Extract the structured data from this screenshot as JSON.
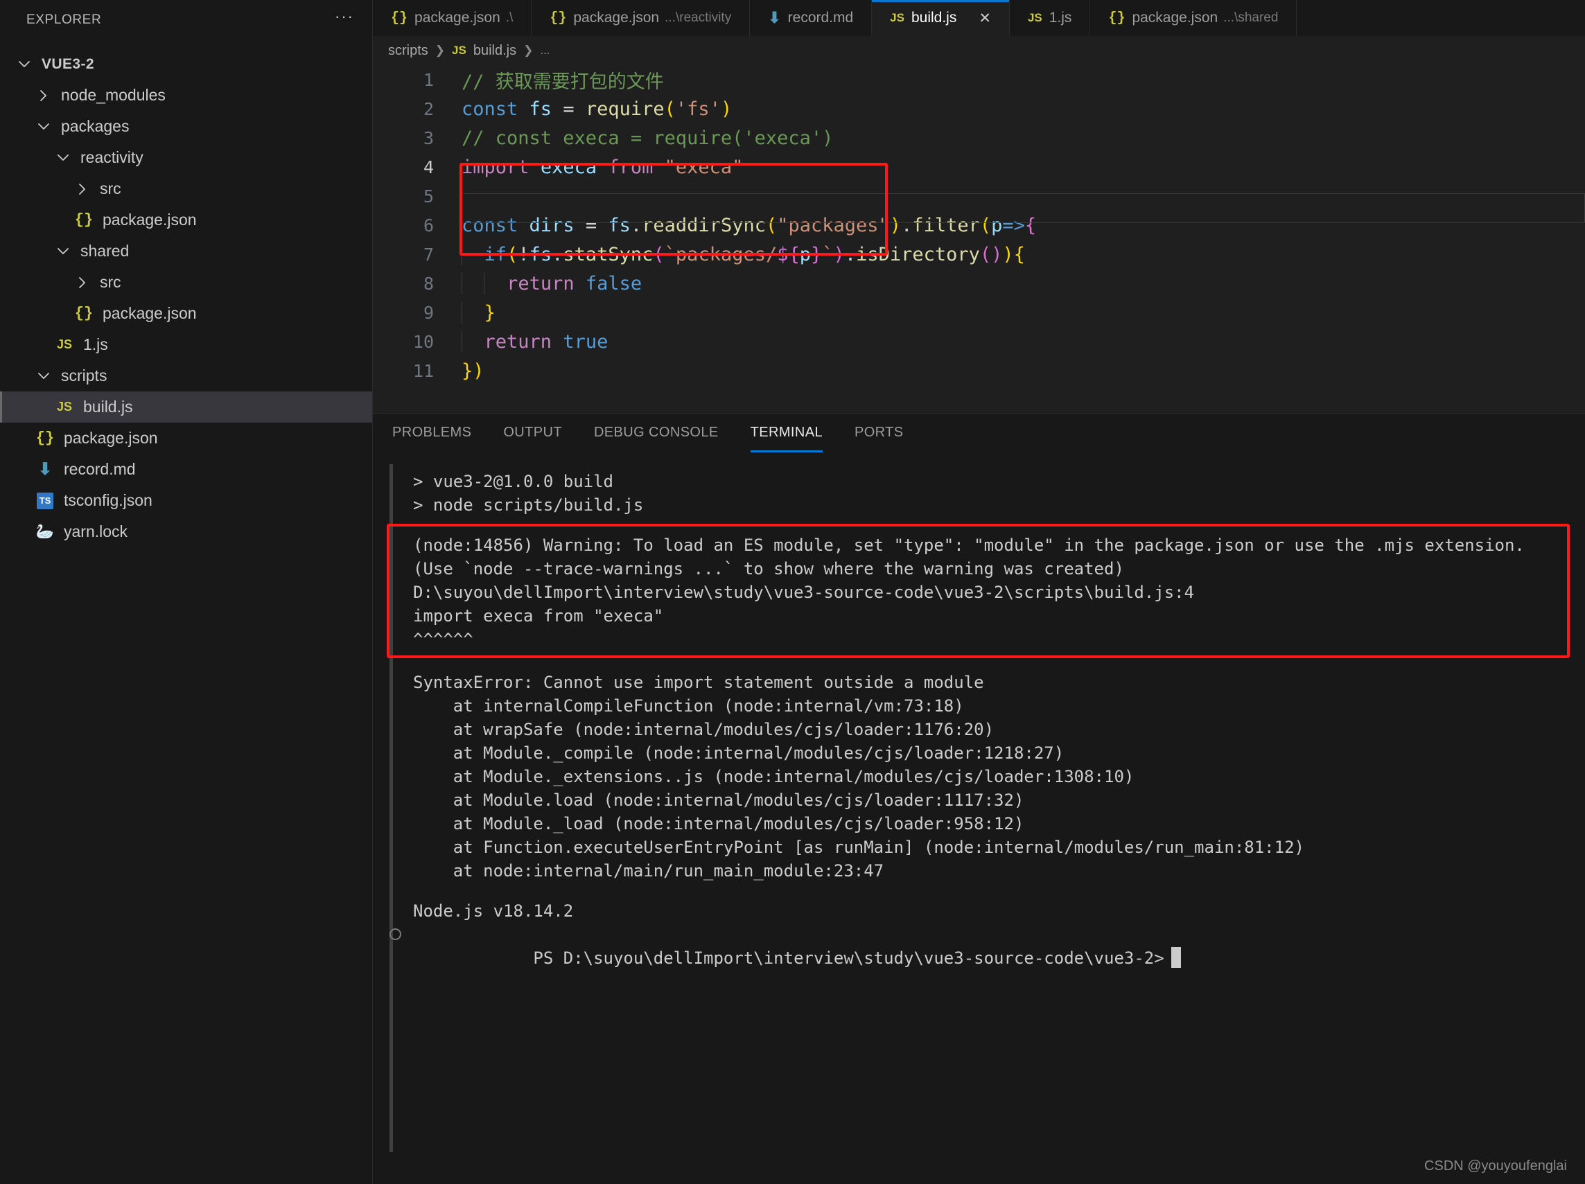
{
  "sidebar": {
    "title": "EXPLORER",
    "more_label": "···",
    "tree": [
      {
        "label": "VUE3-2",
        "indent": 0,
        "twisty": "down",
        "icon": "none",
        "bold": true,
        "selected": false
      },
      {
        "label": "node_modules",
        "indent": 1,
        "twisty": "right",
        "icon": "none",
        "bold": false,
        "selected": false
      },
      {
        "label": "packages",
        "indent": 1,
        "twisty": "down",
        "icon": "none",
        "bold": false,
        "selected": false
      },
      {
        "label": "reactivity",
        "indent": 2,
        "twisty": "down",
        "icon": "none",
        "bold": false,
        "selected": false
      },
      {
        "label": "src",
        "indent": 3,
        "twisty": "right",
        "icon": "none",
        "bold": false,
        "selected": false
      },
      {
        "label": "package.json",
        "indent": 3,
        "twisty": "none",
        "icon": "json",
        "bold": false,
        "selected": false
      },
      {
        "label": "shared",
        "indent": 2,
        "twisty": "down",
        "icon": "none",
        "bold": false,
        "selected": false
      },
      {
        "label": "src",
        "indent": 3,
        "twisty": "right",
        "icon": "none",
        "bold": false,
        "selected": false
      },
      {
        "label": "package.json",
        "indent": 3,
        "twisty": "none",
        "icon": "json",
        "bold": false,
        "selected": false
      },
      {
        "label": "1.js",
        "indent": 2,
        "twisty": "none",
        "icon": "js",
        "bold": false,
        "selected": false
      },
      {
        "label": "scripts",
        "indent": 1,
        "twisty": "down",
        "icon": "none",
        "bold": false,
        "selected": false
      },
      {
        "label": "build.js",
        "indent": 2,
        "twisty": "none",
        "icon": "js",
        "bold": false,
        "selected": true
      },
      {
        "label": "package.json",
        "indent": 1,
        "twisty": "none",
        "icon": "json",
        "bold": false,
        "selected": false
      },
      {
        "label": "record.md",
        "indent": 1,
        "twisty": "none",
        "icon": "md",
        "bold": false,
        "selected": false
      },
      {
        "label": "tsconfig.json",
        "indent": 1,
        "twisty": "none",
        "icon": "ts",
        "bold": false,
        "selected": false
      },
      {
        "label": "yarn.lock",
        "indent": 1,
        "twisty": "none",
        "icon": "lock",
        "bold": false,
        "selected": false
      }
    ]
  },
  "tabs": [
    {
      "label": "package.json",
      "desc": ".\\",
      "icon": "json",
      "active": false,
      "closable": false
    },
    {
      "label": "package.json",
      "desc": "...\\reactivity",
      "icon": "json",
      "active": false,
      "closable": false
    },
    {
      "label": "record.md",
      "desc": "",
      "icon": "md",
      "active": false,
      "closable": false
    },
    {
      "label": "build.js",
      "desc": "",
      "icon": "js",
      "active": true,
      "closable": true,
      "close_label": "✕"
    },
    {
      "label": "1.js",
      "desc": "",
      "icon": "js",
      "active": false,
      "closable": false
    },
    {
      "label": "package.json",
      "desc": "...\\shared",
      "icon": "json",
      "active": false,
      "closable": false
    }
  ],
  "breadcrumb": {
    "folder": "scripts",
    "sep1": "❯",
    "file": "build.js",
    "sep2": "❯",
    "ellipsis": "..."
  },
  "editor": {
    "lines": [
      {
        "n": "1",
        "text": "// 获取需要打包的文件"
      },
      {
        "n": "2",
        "text": "const fs = require('fs')"
      },
      {
        "n": "3",
        "text": "// const execa = require('execa')"
      },
      {
        "n": "4",
        "text": "import execa from \"execa\""
      },
      {
        "n": "5",
        "text": ""
      },
      {
        "n": "6",
        "text": "const dirs = fs.readdirSync(\"packages\").filter(p=>{"
      },
      {
        "n": "7",
        "text": "  if(!fs.statSync(`packages/${p}`).isDirectory()){"
      },
      {
        "n": "8",
        "text": "    return false"
      },
      {
        "n": "9",
        "text": "  }"
      },
      {
        "n": "10",
        "text": "  return true"
      },
      {
        "n": "11",
        "text": "})"
      }
    ]
  },
  "panel": {
    "tabs": [
      {
        "label": "PROBLEMS",
        "active": false
      },
      {
        "label": "OUTPUT",
        "active": false
      },
      {
        "label": "DEBUG CONSOLE",
        "active": false
      },
      {
        "label": "TERMINAL",
        "active": true
      },
      {
        "label": "PORTS",
        "active": false
      }
    ],
    "terminal": {
      "run_lines": [
        "> vue3-2@1.0.0 build",
        "> node scripts/build.js"
      ],
      "warning_lines": [
        "(node:14856) Warning: To load an ES module, set \"type\": \"module\" in the package.json or use the .mjs extension.",
        "(Use `node --trace-warnings ...` to show where the warning was created)",
        "D:\\suyou\\dellImport\\interview\\study\\vue3-source-code\\vue3-2\\scripts\\build.js:4",
        "import execa from \"execa\"",
        "^^^^^^"
      ],
      "error_lines": [
        "SyntaxError: Cannot use import statement outside a module",
        "    at internalCompileFunction (node:internal/vm:73:18)",
        "    at wrapSafe (node:internal/modules/cjs/loader:1176:20)",
        "    at Module._compile (node:internal/modules/cjs/loader:1218:27)",
        "    at Module._extensions..js (node:internal/modules/cjs/loader:1308:10)",
        "    at Module.load (node:internal/modules/cjs/loader:1117:32)",
        "    at Module._load (node:internal/modules/cjs/loader:958:12)",
        "    at Function.executeUserEntryPoint [as runMain] (node:internal/modules/run_main:81:12)",
        "    at node:internal/main/run_main_module:23:47"
      ],
      "version_line": "Node.js v18.14.2",
      "prompt_line": "PS D:\\suyou\\dellImport\\interview\\study\\vue3-source-code\\vue3-2>"
    }
  },
  "watermark": "CSDN @youyoufenglai",
  "colors": {
    "accent": "#0078d4",
    "highlight_box": "#ff1a1a",
    "sidebar_bg": "#181818",
    "editor_bg": "#1f1f1f"
  }
}
